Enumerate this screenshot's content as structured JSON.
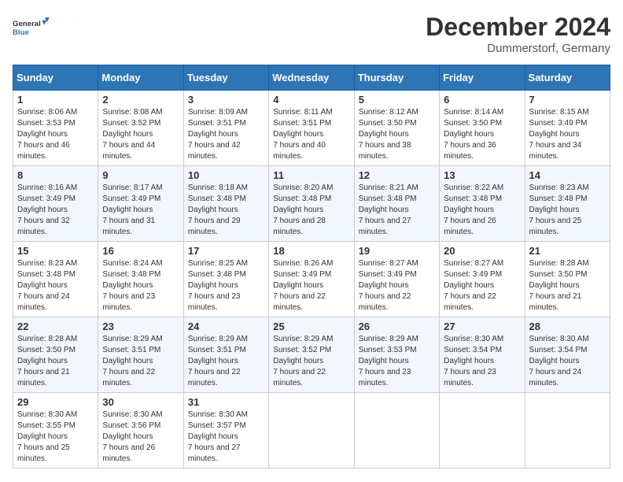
{
  "logo": {
    "text_general": "General",
    "text_blue": "Blue"
  },
  "header": {
    "title": "December 2024",
    "subtitle": "Dummerstorf, Germany"
  },
  "days_of_week": [
    "Sunday",
    "Monday",
    "Tuesday",
    "Wednesday",
    "Thursday",
    "Friday",
    "Saturday"
  ],
  "weeks": [
    [
      {
        "day": "1",
        "sunrise": "8:06 AM",
        "sunset": "3:53 PM",
        "daylight": "7 hours and 46 minutes."
      },
      {
        "day": "2",
        "sunrise": "8:08 AM",
        "sunset": "3:52 PM",
        "daylight": "7 hours and 44 minutes."
      },
      {
        "day": "3",
        "sunrise": "8:09 AM",
        "sunset": "3:51 PM",
        "daylight": "7 hours and 42 minutes."
      },
      {
        "day": "4",
        "sunrise": "8:11 AM",
        "sunset": "3:51 PM",
        "daylight": "7 hours and 40 minutes."
      },
      {
        "day": "5",
        "sunrise": "8:12 AM",
        "sunset": "3:50 PM",
        "daylight": "7 hours and 38 minutes."
      },
      {
        "day": "6",
        "sunrise": "8:14 AM",
        "sunset": "3:50 PM",
        "daylight": "7 hours and 36 minutes."
      },
      {
        "day": "7",
        "sunrise": "8:15 AM",
        "sunset": "3:49 PM",
        "daylight": "7 hours and 34 minutes."
      }
    ],
    [
      {
        "day": "8",
        "sunrise": "8:16 AM",
        "sunset": "3:49 PM",
        "daylight": "7 hours and 32 minutes."
      },
      {
        "day": "9",
        "sunrise": "8:17 AM",
        "sunset": "3:49 PM",
        "daylight": "7 hours and 31 minutes."
      },
      {
        "day": "10",
        "sunrise": "8:18 AM",
        "sunset": "3:48 PM",
        "daylight": "7 hours and 29 minutes."
      },
      {
        "day": "11",
        "sunrise": "8:20 AM",
        "sunset": "3:48 PM",
        "daylight": "7 hours and 28 minutes."
      },
      {
        "day": "12",
        "sunrise": "8:21 AM",
        "sunset": "3:48 PM",
        "daylight": "7 hours and 27 minutes."
      },
      {
        "day": "13",
        "sunrise": "8:22 AM",
        "sunset": "3:48 PM",
        "daylight": "7 hours and 26 minutes."
      },
      {
        "day": "14",
        "sunrise": "8:23 AM",
        "sunset": "3:48 PM",
        "daylight": "7 hours and 25 minutes."
      }
    ],
    [
      {
        "day": "15",
        "sunrise": "8:23 AM",
        "sunset": "3:48 PM",
        "daylight": "7 hours and 24 minutes."
      },
      {
        "day": "16",
        "sunrise": "8:24 AM",
        "sunset": "3:48 PM",
        "daylight": "7 hours and 23 minutes."
      },
      {
        "day": "17",
        "sunrise": "8:25 AM",
        "sunset": "3:48 PM",
        "daylight": "7 hours and 23 minutes."
      },
      {
        "day": "18",
        "sunrise": "8:26 AM",
        "sunset": "3:49 PM",
        "daylight": "7 hours and 22 minutes."
      },
      {
        "day": "19",
        "sunrise": "8:27 AM",
        "sunset": "3:49 PM",
        "daylight": "7 hours and 22 minutes."
      },
      {
        "day": "20",
        "sunrise": "8:27 AM",
        "sunset": "3:49 PM",
        "daylight": "7 hours and 22 minutes."
      },
      {
        "day": "21",
        "sunrise": "8:28 AM",
        "sunset": "3:50 PM",
        "daylight": "7 hours and 21 minutes."
      }
    ],
    [
      {
        "day": "22",
        "sunrise": "8:28 AM",
        "sunset": "3:50 PM",
        "daylight": "7 hours and 21 minutes."
      },
      {
        "day": "23",
        "sunrise": "8:29 AM",
        "sunset": "3:51 PM",
        "daylight": "7 hours and 22 minutes."
      },
      {
        "day": "24",
        "sunrise": "8:29 AM",
        "sunset": "3:51 PM",
        "daylight": "7 hours and 22 minutes."
      },
      {
        "day": "25",
        "sunrise": "8:29 AM",
        "sunset": "3:52 PM",
        "daylight": "7 hours and 22 minutes."
      },
      {
        "day": "26",
        "sunrise": "8:29 AM",
        "sunset": "3:53 PM",
        "daylight": "7 hours and 23 minutes."
      },
      {
        "day": "27",
        "sunrise": "8:30 AM",
        "sunset": "3:54 PM",
        "daylight": "7 hours and 23 minutes."
      },
      {
        "day": "28",
        "sunrise": "8:30 AM",
        "sunset": "3:54 PM",
        "daylight": "7 hours and 24 minutes."
      }
    ],
    [
      {
        "day": "29",
        "sunrise": "8:30 AM",
        "sunset": "3:55 PM",
        "daylight": "7 hours and 25 minutes."
      },
      {
        "day": "30",
        "sunrise": "8:30 AM",
        "sunset": "3:56 PM",
        "daylight": "7 hours and 26 minutes."
      },
      {
        "day": "31",
        "sunrise": "8:30 AM",
        "sunset": "3:57 PM",
        "daylight": "7 hours and 27 minutes."
      },
      null,
      null,
      null,
      null
    ]
  ]
}
